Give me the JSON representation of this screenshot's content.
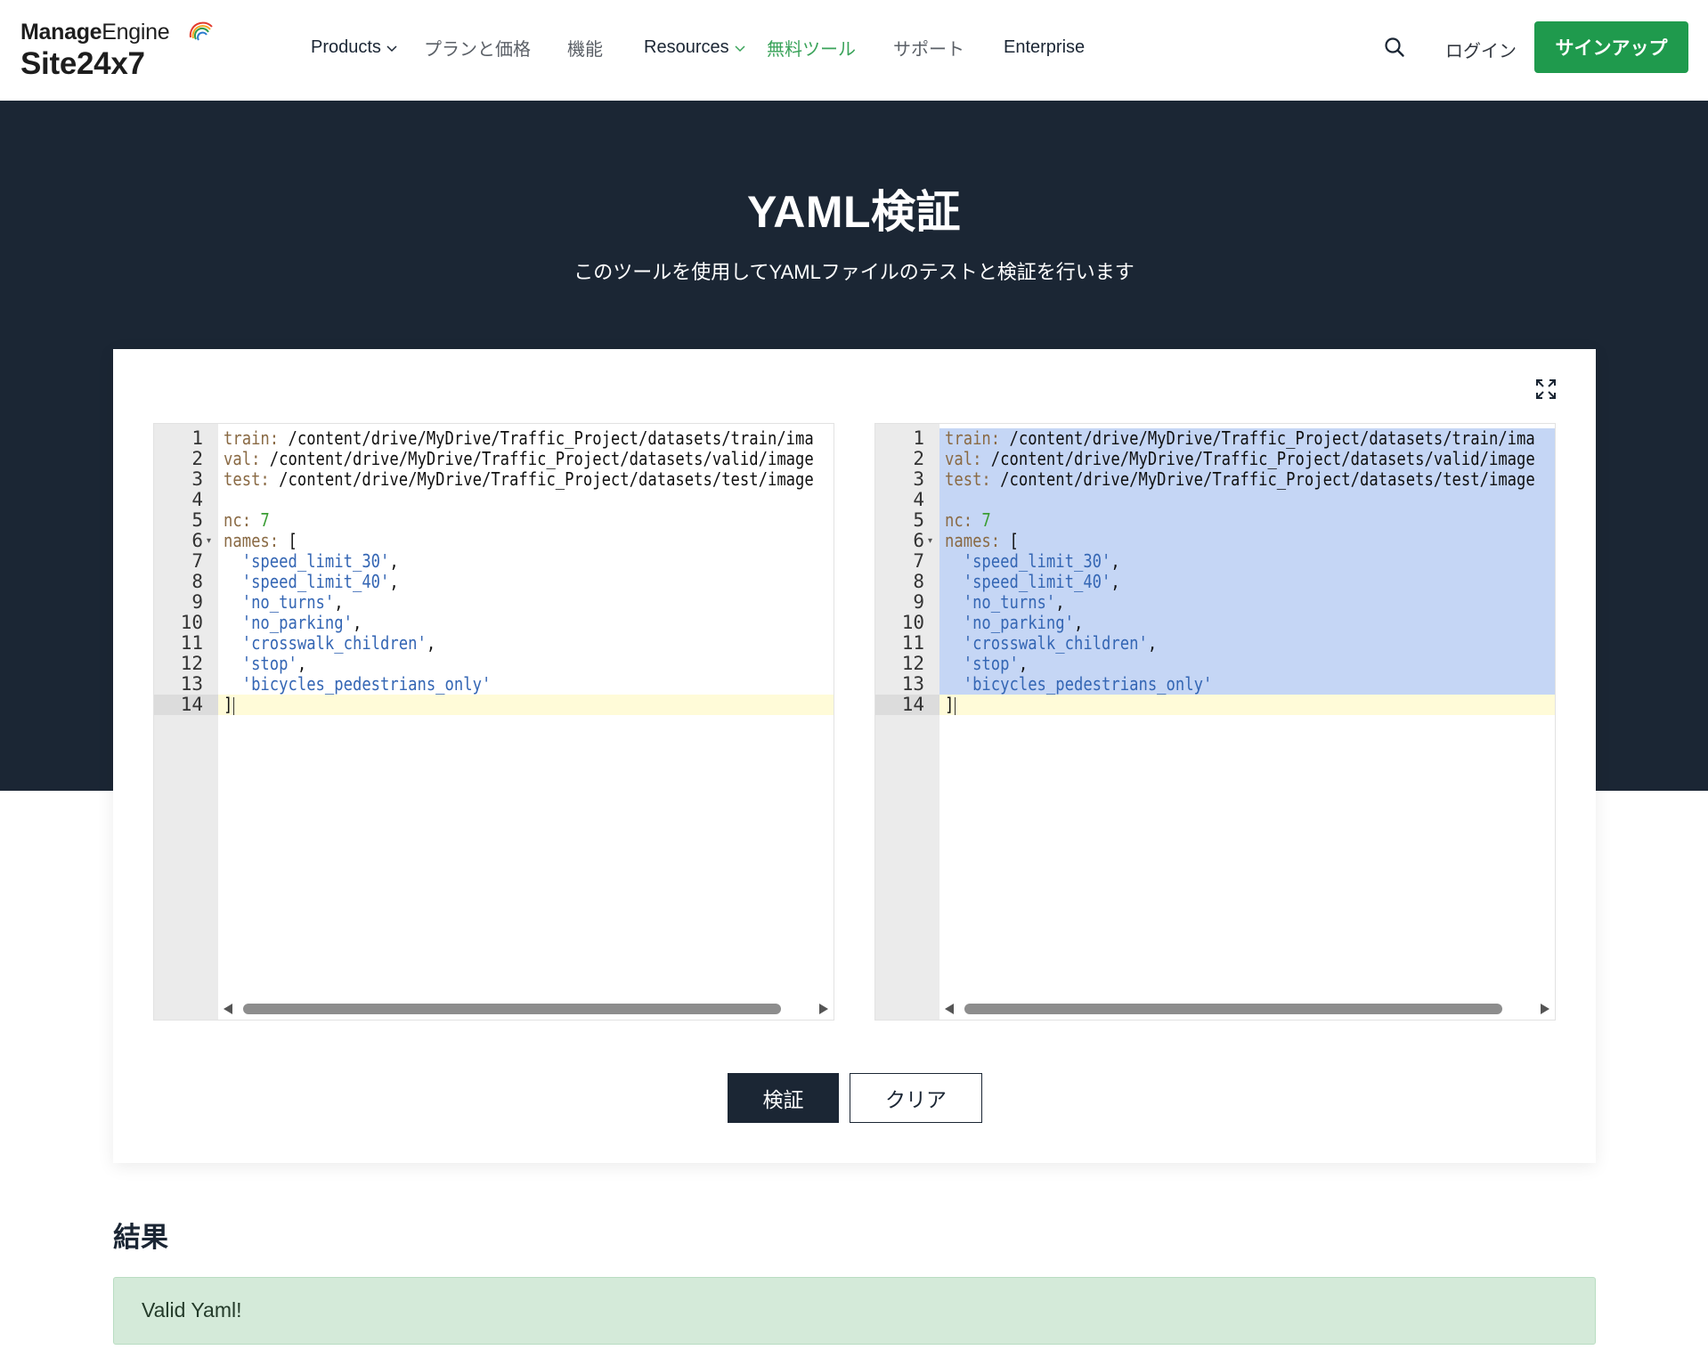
{
  "header": {
    "logo_brand_bold": "Manage",
    "logo_brand_light": "Engine",
    "logo_product": "Site24x7",
    "nav": {
      "products": "Products",
      "pricing": "プランと価格",
      "features": "機能",
      "resources": "Resources",
      "free_tools": "無料ツール",
      "support": "サポート",
      "enterprise": "Enterprise"
    },
    "login": "ログイン",
    "signup": "サインアップ",
    "colors": {
      "signup_bg": "#1f9a4d",
      "active_nav": "#3aa35a"
    }
  },
  "hero": {
    "title": "YAML検証",
    "subtitle": "このツールを使用してYAMLファイルのテストと検証を行います"
  },
  "editor": {
    "line_numbers": [
      "1",
      "2",
      "3",
      "4",
      "5",
      "6",
      "7",
      "8",
      "9",
      "10",
      "11",
      "12",
      "13",
      "14"
    ],
    "active_line": 14,
    "left_lines": [
      {
        "key": "train:",
        "rest": " /content/drive/MyDrive/Traffic_Project/datasets/train/ima"
      },
      {
        "key": "val:",
        "rest": " /content/drive/MyDrive/Traffic_Project/datasets/valid/image"
      },
      {
        "key": "test:",
        "rest": " /content/drive/MyDrive/Traffic_Project/datasets/test/image"
      },
      {
        "key": "",
        "rest": ""
      },
      {
        "key": "nc:",
        "num": " 7"
      },
      {
        "key": "names:",
        "rest": " ["
      },
      {
        "str": "  'speed_limit_30'",
        "rest": ","
      },
      {
        "str": "  'speed_limit_40'",
        "rest": ","
      },
      {
        "str": "  'no_turns'",
        "rest": ","
      },
      {
        "str": "  'no_parking'",
        "rest": ","
      },
      {
        "str": "  'crosswalk_children'",
        "rest": ","
      },
      {
        "str": "  'stop'",
        "rest": ","
      },
      {
        "str": "  'bicycles_pedestrians_only'",
        "rest": ""
      },
      {
        "rest": "]"
      }
    ],
    "right_lines": [
      {
        "key": "train:",
        "rest": " /content/drive/MyDrive/Traffic_Project/datasets/train/ima"
      },
      {
        "key": "val:",
        "rest": " /content/drive/MyDrive/Traffic_Project/datasets/valid/image"
      },
      {
        "key": "test:",
        "rest": " /content/drive/MyDrive/Traffic_Project/datasets/test/image"
      },
      {
        "key": "",
        "rest": ""
      },
      {
        "key": "nc:",
        "num": " 7"
      },
      {
        "key": "names:",
        "rest": " ["
      },
      {
        "str": "  'speed_limit_30'",
        "rest": ","
      },
      {
        "str": "  'speed_limit_40'",
        "rest": ","
      },
      {
        "str": "  'no_turns'",
        "rest": ","
      },
      {
        "str": "  'no_parking'",
        "rest": ","
      },
      {
        "str": "  'crosswalk_children'",
        "rest": ","
      },
      {
        "str": "  'stop'",
        "rest": ","
      },
      {
        "str": "  'bicycles_pedestrians_only'",
        "rest": ""
      },
      {
        "rest": "]"
      }
    ],
    "right_selected": true
  },
  "buttons": {
    "validate": "検証",
    "clear": "クリア"
  },
  "result": {
    "title": "結果",
    "message": "Valid Yaml!"
  },
  "icons": {
    "search": "search-icon",
    "expand": "expand-icon",
    "chevron": "chevron-down-icon"
  }
}
